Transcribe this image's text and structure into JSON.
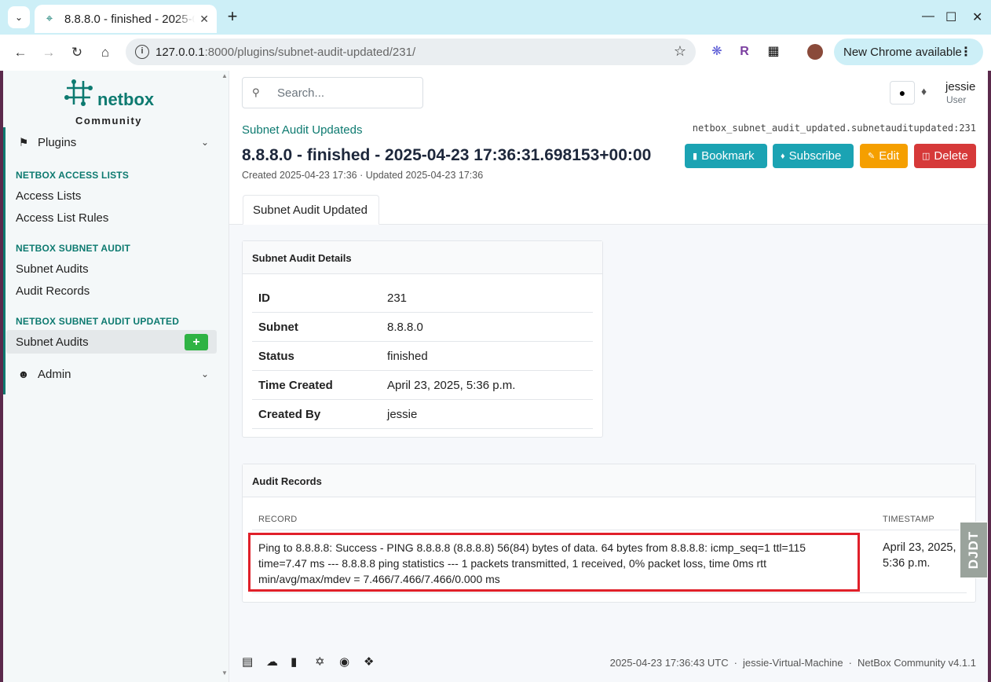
{
  "browser": {
    "tab_title": "8.8.8.0 - finished - 2025-0",
    "url_host": "127.0.0.1",
    "url_path": ":8000/plugins/subnet-audit-updated/231/",
    "new_chrome_label": "New Chrome available"
  },
  "logo": {
    "brand": "netbox",
    "edition": "Community"
  },
  "sidebar": {
    "plugins_label": "Plugins",
    "sections": [
      {
        "heading": "NETBOX ACCESS LISTS",
        "items": [
          "Access Lists",
          "Access List Rules"
        ]
      },
      {
        "heading": "NETBOX SUBNET AUDIT",
        "items": [
          "Subnet Audits",
          "Audit Records"
        ]
      },
      {
        "heading": "NETBOX SUBNET AUDIT UPDATED",
        "items": [
          "Subnet Audits"
        ]
      }
    ],
    "admin_label": "Admin"
  },
  "header": {
    "search_placeholder": "Search...",
    "user_name": "jessie",
    "user_role": "User"
  },
  "object": {
    "breadcrumb": "Subnet Audit Updateds",
    "model_path": "netbox_subnet_audit_updated.subnetauditupdated:231",
    "title": "8.8.8.0 - finished - 2025-04-23 17:36:31.698153+00:00",
    "meta": "Created 2025-04-23 17:36 · Updated 2025-04-23 17:36",
    "buttons": {
      "bookmark": "Bookmark",
      "subscribe": "Subscribe",
      "edit": "Edit",
      "delete": "Delete"
    },
    "tab": "Subnet Audit Updated"
  },
  "details": {
    "title": "Subnet Audit Details",
    "rows": [
      {
        "label": "ID",
        "value": "231"
      },
      {
        "label": "Subnet",
        "value": "8.8.8.0"
      },
      {
        "label": "Status",
        "value": "finished"
      },
      {
        "label": "Time Created",
        "value": "April 23, 2025, 5:36 p.m."
      },
      {
        "label": "Created By",
        "value": "jessie"
      }
    ]
  },
  "records": {
    "title": "Audit Records",
    "columns": [
      "RECORD",
      "TIMESTAMP"
    ],
    "rows": [
      {
        "record": "Ping to 8.8.8.8: Success - PING 8.8.8.8 (8.8.8.8) 56(84) bytes of data. 64 bytes from 8.8.8.8: icmp_seq=1 ttl=115 time=7.47 ms --- 8.8.8.8 ping statistics --- 1 packets transmitted, 1 received, 0% packet loss, time 0ms rtt min/avg/max/mdev = 7.466/7.466/7.466/0.000 ms",
        "timestamp": "April 23, 2025, 5:36 p.m."
      }
    ]
  },
  "djdt_label": "DJDT",
  "footer": {
    "time": "2025-04-23 17:36:43 UTC",
    "host": "jessie-Virtual-Machine",
    "version": "NetBox Community v4.1.1"
  },
  "colors": {
    "brand": "#0d7a70",
    "info": "#1ba3b3",
    "warning": "#f59f00",
    "danger": "#d63939",
    "success": "#2fb344",
    "highlight": "#e0202a"
  }
}
